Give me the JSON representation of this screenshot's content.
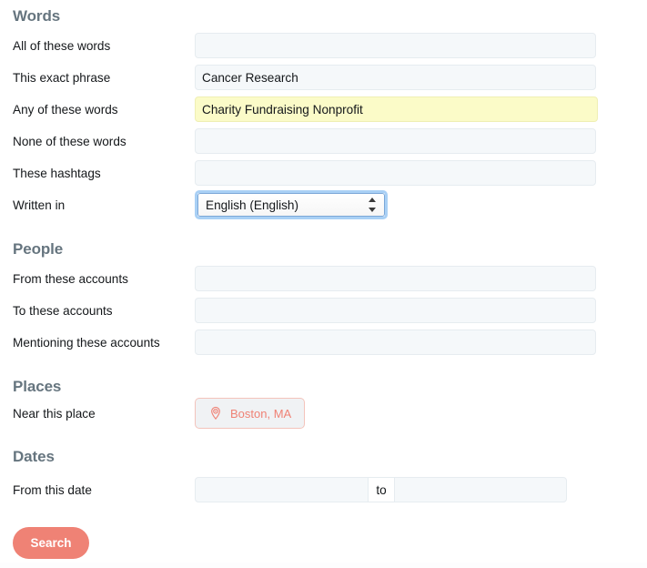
{
  "form": {
    "sections": [
      {
        "id": "words",
        "heading": "Words",
        "rows": [
          {
            "id": "all-of-these-words",
            "label": "All of these words",
            "kind": "text",
            "value": "",
            "placeholder": ""
          },
          {
            "id": "this-exact-phrase",
            "label": "This exact phrase",
            "kind": "text",
            "value": "Cancer Research",
            "placeholder": ""
          },
          {
            "id": "any-of-these-words",
            "label": "Any of these words",
            "kind": "text-highlight",
            "value": "Charity Fundraising Nonprofit",
            "placeholder": ""
          },
          {
            "id": "none-of-these-words",
            "label": "None of these words",
            "kind": "text",
            "value": "",
            "placeholder": ""
          },
          {
            "id": "these-hashtags",
            "label": "These hashtags",
            "kind": "text",
            "value": "",
            "placeholder": ""
          },
          {
            "id": "written-in",
            "label": "Written in",
            "kind": "select",
            "value": "English (English)",
            "options": [
              "English (English)"
            ]
          }
        ]
      },
      {
        "id": "people",
        "heading": "People",
        "rows": [
          {
            "id": "from-these-accounts",
            "label": "From these accounts",
            "kind": "text",
            "value": "",
            "placeholder": ""
          },
          {
            "id": "to-these-accounts",
            "label": "To these accounts",
            "kind": "text",
            "value": "",
            "placeholder": ""
          },
          {
            "id": "mentioning-these-accounts",
            "label": "Mentioning these accounts",
            "kind": "text",
            "value": "",
            "placeholder": ""
          }
        ]
      },
      {
        "id": "places",
        "heading": "Places",
        "rows": [
          {
            "id": "near-this-place",
            "label": "Near this place",
            "kind": "place-pill",
            "value": "Boston, MA",
            "icon": "location-pin-icon"
          }
        ]
      },
      {
        "id": "dates",
        "heading": "Dates",
        "rows": [
          {
            "id": "from-this-date",
            "label": "From this date",
            "kind": "date-range",
            "value_from": "",
            "value_to": "",
            "separator": "to",
            "placeholder_from": "",
            "placeholder_to": ""
          }
        ]
      }
    ],
    "submit_label": "Search"
  },
  "colors": {
    "heading": "#66757f",
    "label_text": "#14171a",
    "input_bg": "#f5f8fa",
    "input_border": "#e6ecf0",
    "highlight_bg": "#fbfbc8",
    "highlight_border": "#efefb4",
    "accent": "#ef8275",
    "focus_ring": "#a9d0f5",
    "place_pill_bg": "#f0f2f4",
    "place_pill_border": "#f3c3bb"
  }
}
